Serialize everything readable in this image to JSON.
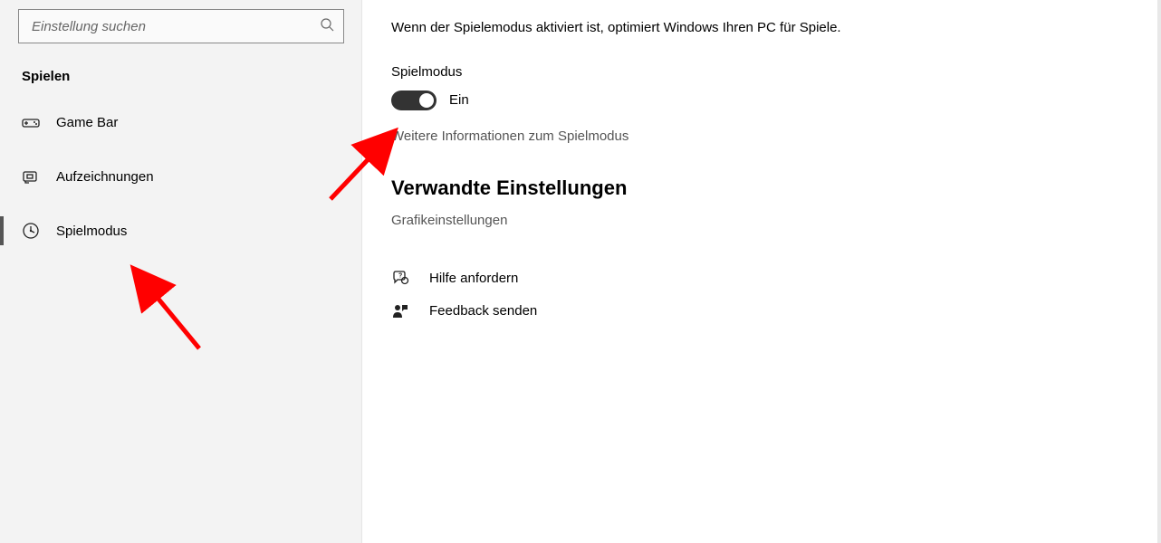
{
  "search": {
    "placeholder": "Einstellung suchen"
  },
  "category": "Spielen",
  "nav": {
    "items": [
      {
        "label": "Game Bar"
      },
      {
        "label": "Aufzeichnungen"
      },
      {
        "label": "Spielmodus"
      }
    ]
  },
  "main": {
    "description": "Wenn der Spielemodus aktiviert ist, optimiert Windows Ihren PC für Spiele.",
    "toggle_label": "Spielmodus",
    "toggle_state": "Ein",
    "more_info": "Weitere Informationen zum Spielmodus",
    "related_title": "Verwandte Einstellungen",
    "graphics_link": "Grafikeinstellungen",
    "help_label": "Hilfe anfordern",
    "feedback_label": "Feedback senden"
  }
}
